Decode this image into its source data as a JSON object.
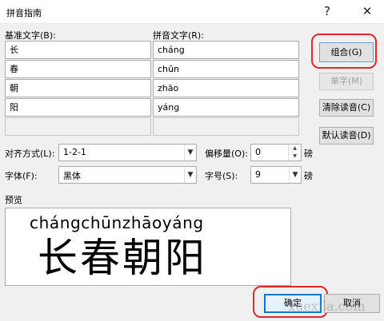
{
  "window": {
    "title": "拼音指南",
    "help_icon": "?",
    "close_icon": "✕"
  },
  "labels": {
    "base_text": "基准文字(B):",
    "pinyin_text": "拼音文字(R):",
    "alignment": "对齐方式(L):",
    "offset": "偏移量(O):",
    "offset_unit": "磅",
    "font": "字体(F):",
    "size": "字号(S):",
    "size_unit": "磅",
    "preview": "预览"
  },
  "rows": [
    {
      "base": "长",
      "pinyin": "cháng"
    },
    {
      "base": "春",
      "pinyin": "chūn"
    },
    {
      "base": "朝",
      "pinyin": "zhāo"
    },
    {
      "base": "阳",
      "pinyin": "yáng"
    },
    {
      "base": "",
      "pinyin": ""
    }
  ],
  "buttons": {
    "group": "组合(G)",
    "single": "单字(M)",
    "clear": "清除读音(C)",
    "default": "默认读音(D)",
    "ok": "确定",
    "cancel": "取消"
  },
  "fields": {
    "alignment": "1-2-1",
    "offset": "0",
    "font": "黑体",
    "size": "9"
  },
  "preview": {
    "ruby": "chángchūnzhāoyáng",
    "base": "长春朝阳"
  },
  "watermark": "xuexila.com",
  "colors": {
    "highlight_oval": "#e0282a",
    "primary_border": "#0078d7"
  }
}
